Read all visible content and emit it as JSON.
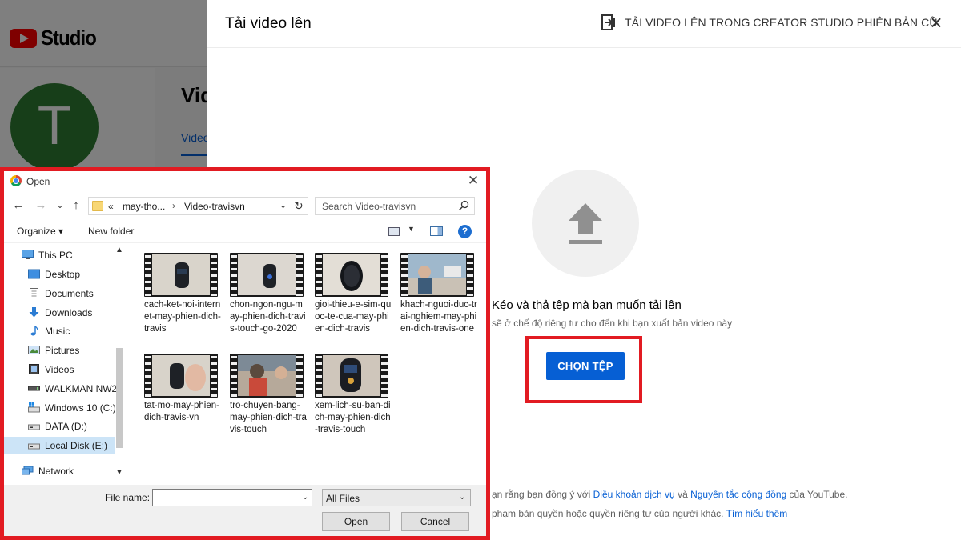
{
  "background": {
    "logo_text": "Studio",
    "avatar_letter": "T",
    "page_title": "Vid",
    "tab_label": "Video"
  },
  "upload_dialog": {
    "title": "Tải video lên",
    "legacy_link": "TẢI VIDEO LÊN TRONG CREATOR STUDIO PHIÊN BẢN CŨ",
    "close_icon": "×",
    "drag_text": "Kéo và thả tệp mà bạn muốn tải lên",
    "privacy_text": "sẽ ở chế độ riêng tư cho đến khi bạn xuất bản video này",
    "choose_button": "CHỌN TỆP",
    "terms_prefix": "ạn rằng bạn đồng ý với",
    "terms_link": "Điều khoản dịch vụ",
    "terms_and": "và",
    "guidelines_link": "Nguyên tắc cộng đồng",
    "terms_suffix": "của YouTube.",
    "copyright_text": "phạm bản quyền hoặc quyền riêng tư của người khác.",
    "learn_more_link": "Tìm hiểu thêm",
    "accent_color": "#065fd4",
    "highlight_color": "#e21b22"
  },
  "open_dialog": {
    "title": "Open",
    "close_icon": "✕",
    "nav": {
      "back": "←",
      "forward": "→",
      "recent": "⌄",
      "up": "↑"
    },
    "breadcrumb": {
      "prefix": "«",
      "folder1": "may-tho...",
      "separator": "›",
      "folder2": "Video-travisvn"
    },
    "refresh": "↻",
    "search_placeholder": "Search Video-travisvn",
    "toolbar": {
      "organize": "Organize ▾",
      "new_folder": "New folder",
      "help": "?"
    },
    "nav_items": [
      {
        "label": "This PC",
        "icon": "computer-icon"
      },
      {
        "label": "Desktop",
        "icon": "desktop-folder-icon"
      },
      {
        "label": "Documents",
        "icon": "documents-icon"
      },
      {
        "label": "Downloads",
        "icon": "downloads-icon"
      },
      {
        "label": "Music",
        "icon": "music-icon"
      },
      {
        "label": "Pictures",
        "icon": "pictures-icon"
      },
      {
        "label": "Videos",
        "icon": "videos-icon"
      },
      {
        "label": "WALKMAN NW2",
        "icon": "usb-drive-icon"
      },
      {
        "label": "Windows 10 (C:)",
        "icon": "windows-drive-icon"
      },
      {
        "label": "DATA (D:)",
        "icon": "drive-icon"
      },
      {
        "label": "Local Disk (E:)",
        "icon": "drive-icon",
        "selected": true
      },
      {
        "label": "Network",
        "icon": "network-icon"
      }
    ],
    "files": [
      "cach-ket-noi-internet-may-phien-dich-travis",
      "chon-ngon-ngu-may-phien-dich-travis-touch-go-2020",
      "gioi-thieu-e-sim-quoc-te-cua-may-phien-dich-travis",
      "khach-nguoi-duc-trai-nghiem-may-phien-dich-travis-one",
      "tat-mo-may-phien-dich-travis-vn",
      "tro-chuyen-bang-may-phien-dich-travis-touch",
      "xem-lich-su-ban-dich-may-phien-dich-travis-touch"
    ],
    "filename_label": "File name:",
    "filename_value": "",
    "filetype_value": "All Files",
    "open_button": "Open",
    "cancel_button": "Cancel"
  }
}
